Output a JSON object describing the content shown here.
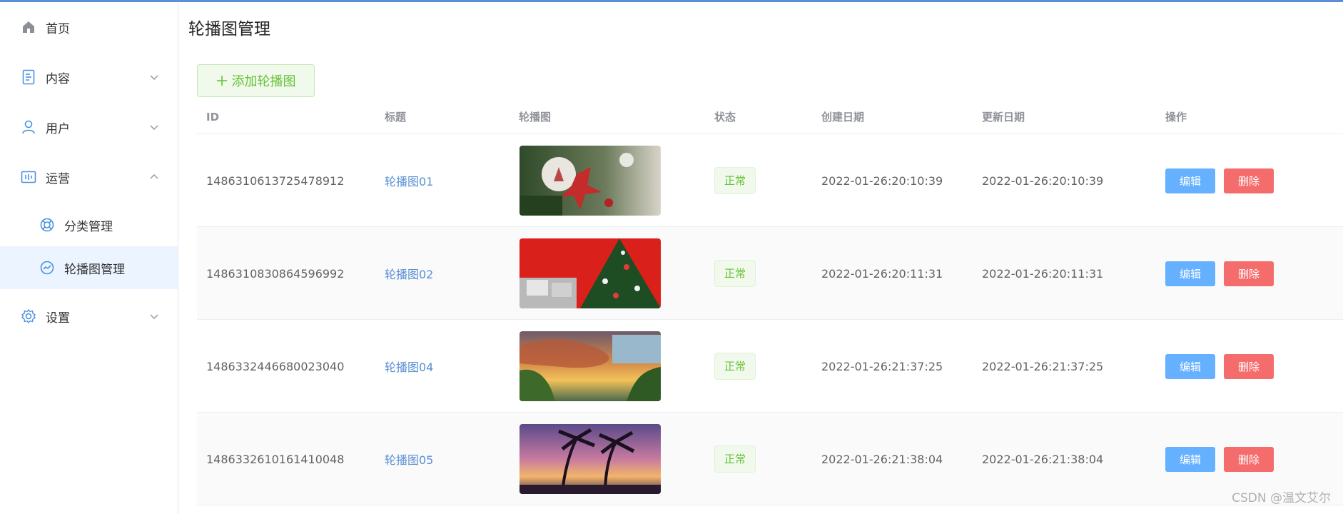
{
  "colors": {
    "accent": "#409eff",
    "success": "#67c23a",
    "danger": "#f56c6c",
    "link": "#5a8fd4",
    "top_strip": "#5b8ed6"
  },
  "sidebar": {
    "items": [
      {
        "label": "首页",
        "icon": "home-icon"
      },
      {
        "label": "内容",
        "icon": "document-icon",
        "expanded": false
      },
      {
        "label": "用户",
        "icon": "user-icon",
        "expanded": false
      },
      {
        "label": "运营",
        "icon": "operation-icon",
        "expanded": true,
        "children": [
          {
            "label": "分类管理",
            "icon": "lifebuoy-icon"
          },
          {
            "label": "轮播图管理",
            "icon": "chart-circle-icon",
            "active": true
          }
        ]
      },
      {
        "label": "设置",
        "icon": "gear-icon",
        "expanded": false
      }
    ]
  },
  "main": {
    "title": "轮播图管理",
    "add_button_label": "添加轮播图",
    "table": {
      "columns": [
        "ID",
        "标题",
        "轮播图",
        "状态",
        "创建日期",
        "更新日期",
        "操作"
      ],
      "rows": [
        {
          "id": "1486310613725478912",
          "title": "轮播图01",
          "image": "christmas-ornament-image",
          "status": "正常",
          "created": "2022-01-26:20:10:39",
          "updated": "2022-01-26:20:10:39"
        },
        {
          "id": "1486310830864596992",
          "title": "轮播图02",
          "image": "christmas-tree-image",
          "status": "正常",
          "created": "2022-01-26:20:11:31",
          "updated": "2022-01-26:20:11:31"
        },
        {
          "id": "1486332446680023040",
          "title": "轮播图04",
          "image": "cloudy-sunset-image",
          "status": "正常",
          "created": "2022-01-26:21:37:25",
          "updated": "2022-01-26:21:37:25"
        },
        {
          "id": "1486332610161410048",
          "title": "轮播图05",
          "image": "palm-beach-sunset-image",
          "status": "正常",
          "created": "2022-01-26:21:38:04",
          "updated": "2022-01-26:21:38:04"
        }
      ],
      "edit_label": "编辑",
      "delete_label": "删除"
    }
  },
  "watermark": "CSDN @温文艾尔"
}
